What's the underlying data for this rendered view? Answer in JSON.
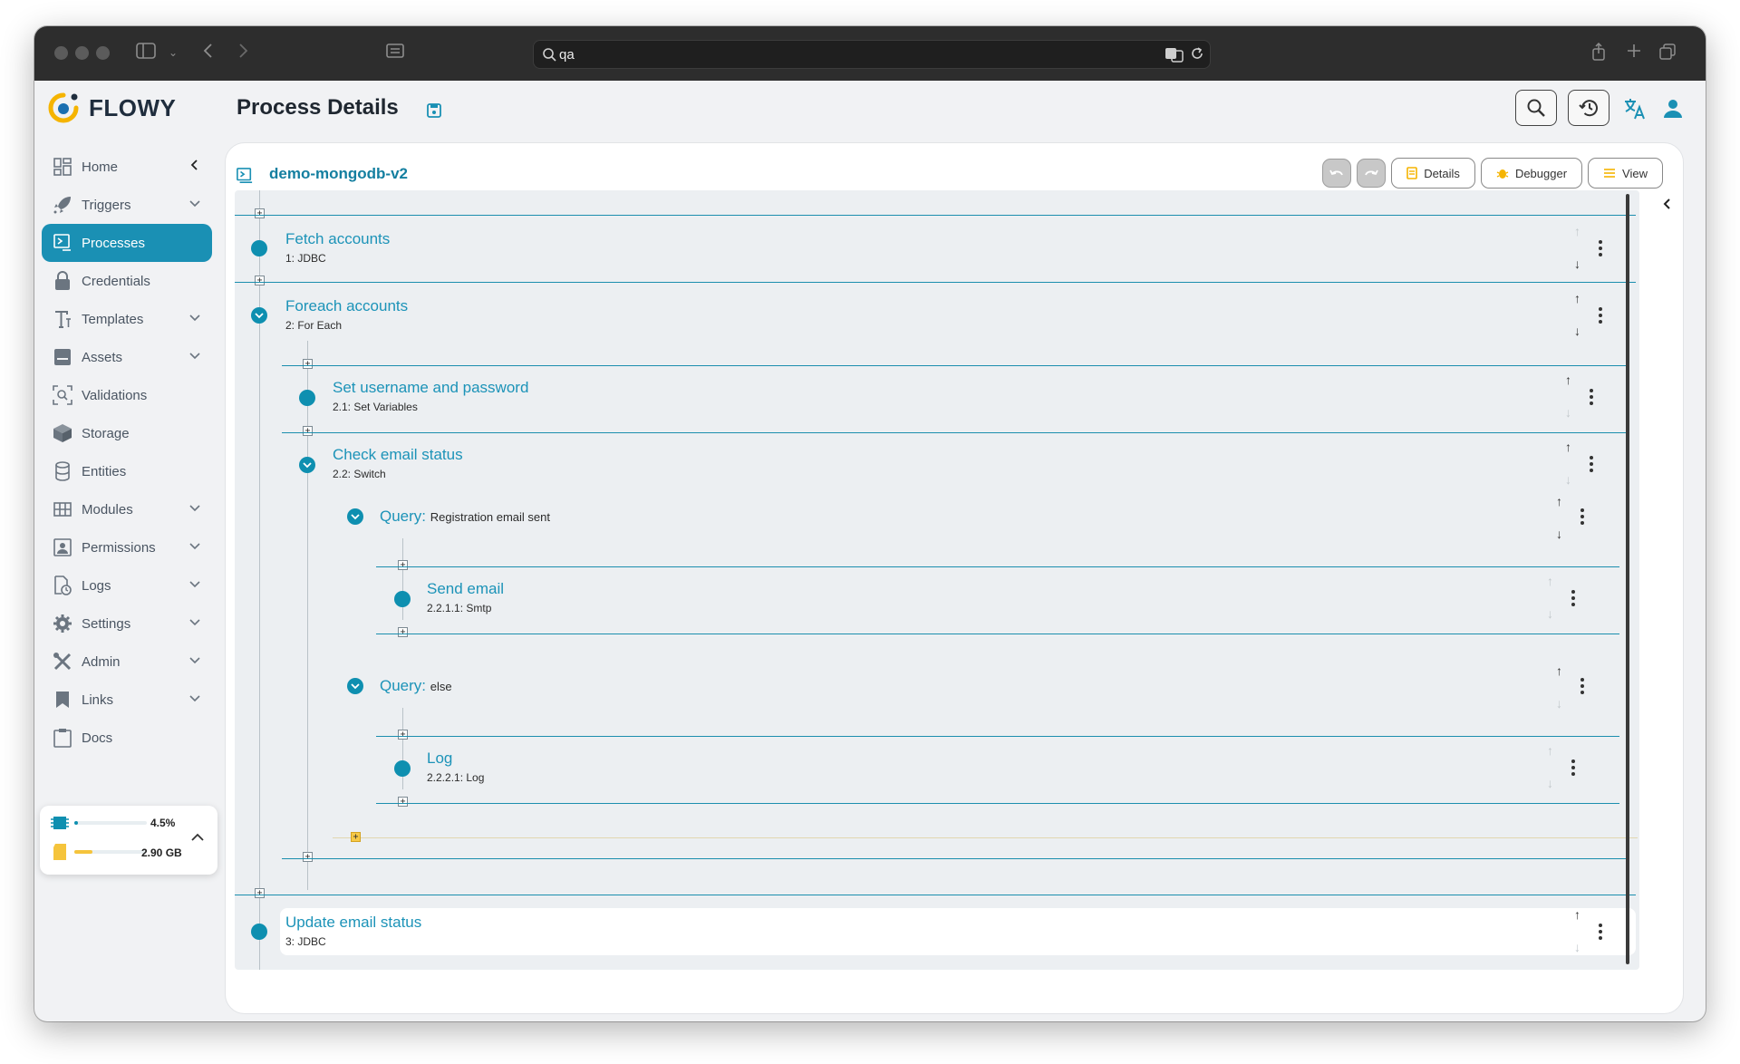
{
  "browser": {
    "url_value": "qa"
  },
  "app": {
    "brand": "FLOWY",
    "page_title": "Process Details"
  },
  "sidebar": {
    "items": [
      {
        "label": "Home"
      },
      {
        "label": "Triggers"
      },
      {
        "label": "Processes"
      },
      {
        "label": "Credentials"
      },
      {
        "label": "Templates"
      },
      {
        "label": "Assets"
      },
      {
        "label": "Validations"
      },
      {
        "label": "Storage"
      },
      {
        "label": "Entities"
      },
      {
        "label": "Modules"
      },
      {
        "label": "Permissions"
      },
      {
        "label": "Logs"
      },
      {
        "label": "Settings"
      },
      {
        "label": "Admin"
      },
      {
        "label": "Links"
      },
      {
        "label": "Docs"
      }
    ],
    "stats": {
      "cpu": "4.5%",
      "cpu_fraction": 0.045,
      "storage": "2.90 GB",
      "storage_fraction": 0.25
    }
  },
  "process": {
    "name": "demo-mongodb-v2",
    "toolbar": {
      "details": "Details",
      "debugger": "Debugger",
      "view": "View"
    },
    "steps": {
      "s1": {
        "title": "Fetch accounts",
        "sub": "1: JDBC"
      },
      "s2": {
        "title": "Foreach accounts",
        "sub": "2: For Each"
      },
      "s21": {
        "title": "Set username and password",
        "sub": "2.1: Set Variables"
      },
      "s22": {
        "title": "Check email status",
        "sub": "2.2: Switch"
      },
      "q1": {
        "label": "Query:",
        "value": "Registration email sent"
      },
      "s2211": {
        "title": "Send email",
        "sub": "2.2.1.1: Smtp"
      },
      "q2": {
        "label": "Query:",
        "value": "else"
      },
      "s2221": {
        "title": "Log",
        "sub": "2.2.2.1: Log"
      },
      "s3": {
        "title": "Update email status",
        "sub": "3: JDBC"
      }
    }
  },
  "colors": {
    "accent": "#1a90b4",
    "node": "#0e8fb0",
    "title_link": "#1c93b8"
  }
}
